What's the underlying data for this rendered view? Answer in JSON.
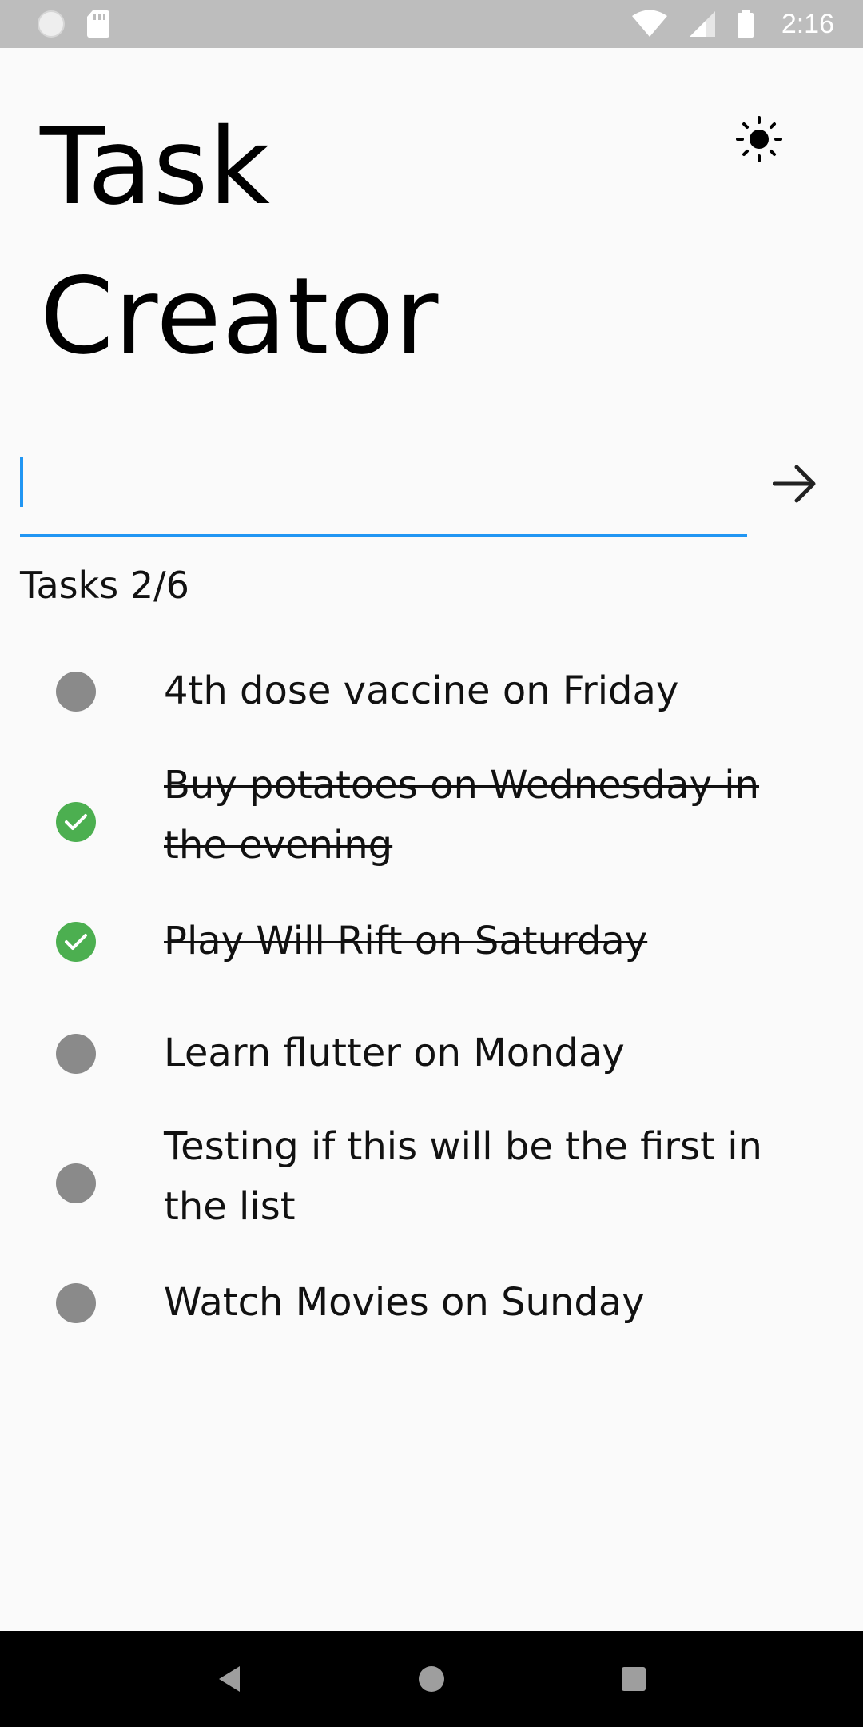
{
  "status_bar": {
    "time": "2:16",
    "icons": [
      "circle-icon",
      "sd-card-icon",
      "wifi-icon",
      "signal-icon",
      "battery-icon"
    ]
  },
  "header": {
    "title_line1": "Task",
    "title_line2": "Creator",
    "theme_icon": "sun-icon"
  },
  "input": {
    "value": "",
    "placeholder": "",
    "submit_icon": "arrow-right-icon",
    "accent_color": "#2196f3"
  },
  "tasks": {
    "count_label": "Tasks 2/6",
    "items": [
      {
        "text": "4th dose vaccine on Friday",
        "done": false
      },
      {
        "text": "Buy potatoes on Wednesday in the evening",
        "done": true
      },
      {
        "text": "Play Will Rift on Saturday",
        "done": true
      },
      {
        "text": "Learn flutter on Monday",
        "done": false
      },
      {
        "text": "Testing if this will be the first in the list",
        "done": false
      },
      {
        "text": "Watch Movies on Sunday",
        "done": false
      }
    ],
    "done_color": "#4caf50",
    "pending_color": "#8a8a8a"
  },
  "nav_bar": {
    "icons": [
      "back-icon",
      "home-icon",
      "recents-icon"
    ]
  }
}
